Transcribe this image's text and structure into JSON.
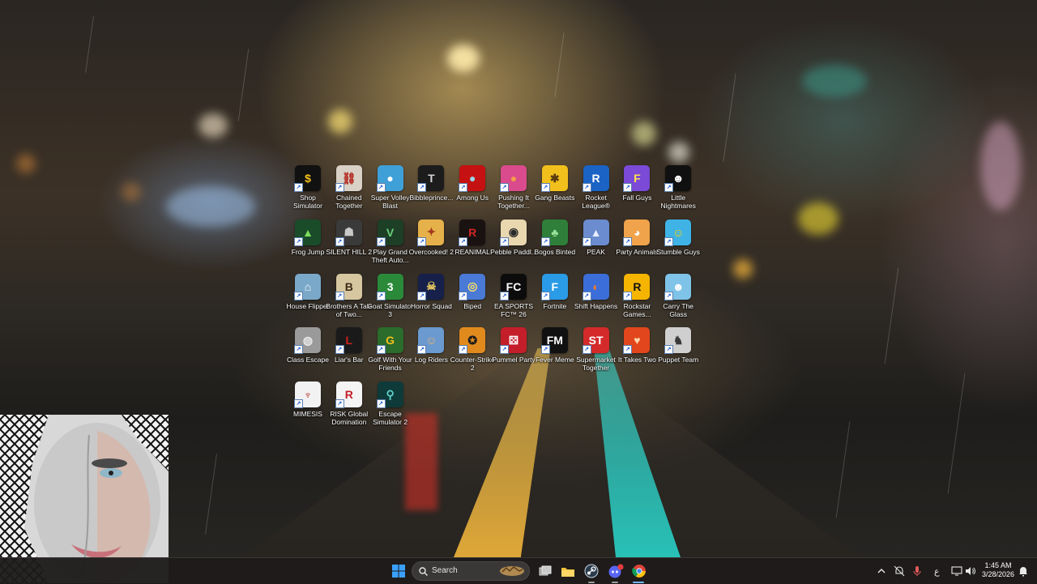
{
  "desktop": {
    "icons": [
      {
        "label": "Shop Simulator",
        "glyph": "$",
        "bg": "#111111",
        "fg": "#f6c21a"
      },
      {
        "label": "Chained Together",
        "glyph": "⛓",
        "bg": "#d9d1c6",
        "fg": "#b3261e"
      },
      {
        "label": "Super Volley Blast",
        "glyph": "●",
        "bg": "#3fa0d8",
        "fg": "#ffffff"
      },
      {
        "label": "Bibbleprince...",
        "glyph": "T",
        "bg": "#1c1c1c",
        "fg": "#d6d6d6"
      },
      {
        "label": "Among Us",
        "glyph": "●",
        "bg": "#c51111",
        "fg": "#9ad4e8"
      },
      {
        "label": "Pushing It Together...",
        "glyph": "●",
        "bg": "#d94b8c",
        "fg": "#f59b4a"
      },
      {
        "label": "Gang Beasts",
        "glyph": "✱",
        "bg": "#f2c01c",
        "fg": "#5a3b10"
      },
      {
        "label": "Rocket League®",
        "glyph": "R",
        "bg": "#1b63c4",
        "fg": "#ffffff"
      },
      {
        "label": "Fall Guys",
        "glyph": "F",
        "bg": "#7b4ad6",
        "fg": "#ffe14d"
      },
      {
        "label": "Little Nightmares",
        "glyph": "☻",
        "bg": "#101010",
        "fg": "#ffffff"
      },
      {
        "label": "Frog Jump",
        "glyph": "▲",
        "bg": "#1a4c2a",
        "fg": "#7ddc5a"
      },
      {
        "label": "SILENT HILL 2",
        "glyph": "☗",
        "bg": "#3a3a3a",
        "fg": "#c8c8c8"
      },
      {
        "label": "Play Grand Theft Auto...",
        "glyph": "V",
        "bg": "#1d3f26",
        "fg": "#6bd07b"
      },
      {
        "label": "Overcooked! 2",
        "glyph": "✦",
        "bg": "#e6b14a",
        "fg": "#a33b1e"
      },
      {
        "label": "REANIMAL",
        "glyph": "R",
        "bg": "#1a1111",
        "fg": "#d02626"
      },
      {
        "label": "Pebble Paddl...",
        "glyph": "◉",
        "bg": "#e9d7b0",
        "fg": "#2a2a2a"
      },
      {
        "label": "Bogos Binted",
        "glyph": "♣",
        "bg": "#2f7f3a",
        "fg": "#9ae39a"
      },
      {
        "label": "PEAK",
        "glyph": "▲",
        "bg": "#6b8ccf",
        "fg": "#e8eefc"
      },
      {
        "label": "Party Animals",
        "glyph": "◕",
        "bg": "#f0a34a",
        "fg": "#ffffff"
      },
      {
        "label": "Stumble Guys",
        "glyph": "☺",
        "bg": "#3fb3e6",
        "fg": "#ffd200"
      },
      {
        "label": "House Flipper",
        "glyph": "⌂",
        "bg": "#7aa8c8",
        "fg": "#ffffff"
      },
      {
        "label": "Brothers A Tale of Two...",
        "glyph": "B",
        "bg": "#d7c7a0",
        "fg": "#3a2a16"
      },
      {
        "label": "Goat Simulator 3",
        "glyph": "3",
        "bg": "#2a8a3a",
        "fg": "#ffffff"
      },
      {
        "label": "Horror Squad",
        "glyph": "☠",
        "bg": "#16204a",
        "fg": "#e8c860"
      },
      {
        "label": "Biped",
        "glyph": "◎",
        "bg": "#4a7ad6",
        "fg": "#ffe066"
      },
      {
        "label": "EA SPORTS FC™ 26",
        "glyph": "FC",
        "bg": "#0c0c0c",
        "fg": "#ffffff"
      },
      {
        "label": "Fortnite",
        "glyph": "F",
        "bg": "#2a9be6",
        "fg": "#ffffff"
      },
      {
        "label": "Shift Happens",
        "glyph": "◐",
        "bg": "#3b6ed8",
        "fg": "#ff7a2a"
      },
      {
        "label": "Rockstar Games...",
        "glyph": "R",
        "bg": "#f4b400",
        "fg": "#111111"
      },
      {
        "label": "Carry The Glass",
        "glyph": "☻",
        "bg": "#7fc3e8",
        "fg": "#ffffff"
      },
      {
        "label": "Class Escape",
        "glyph": "◍",
        "bg": "#9a9a9a",
        "fg": "#e8e8e8"
      },
      {
        "label": "Liar's Bar",
        "glyph": "L",
        "bg": "#1a1a1a",
        "fg": "#d11f1f"
      },
      {
        "label": "Golf With Your Friends",
        "glyph": "G",
        "bg": "#2b6b2b",
        "fg": "#f2c01c"
      },
      {
        "label": "Log Riders",
        "glyph": "☺",
        "bg": "#6a9ad0",
        "fg": "#f0b070"
      },
      {
        "label": "Counter-Strike 2",
        "glyph": "✪",
        "bg": "#e08a1e",
        "fg": "#1a1a1a"
      },
      {
        "label": "Pummel Party",
        "glyph": "⚄",
        "bg": "#c41e2a",
        "fg": "#ffffff"
      },
      {
        "label": "Fever Meme",
        "glyph": "FM",
        "bg": "#111111",
        "fg": "#ffffff"
      },
      {
        "label": "Supermarket Together",
        "glyph": "ST",
        "bg": "#d42a2a",
        "fg": "#ffffff"
      },
      {
        "label": "It Takes Two",
        "glyph": "♥",
        "bg": "#e2461c",
        "fg": "#ffd3a8"
      },
      {
        "label": "Puppet Team",
        "glyph": "♞",
        "bg": "#cfcfcf",
        "fg": "#3a3a3a"
      },
      {
        "label": "MIMESIS",
        "glyph": "♆",
        "bg": "#f2f2f2",
        "fg": "#b3261e"
      },
      {
        "label": "RISK Global Domination",
        "glyph": "R",
        "bg": "#f4f4f4",
        "fg": "#c41e2a"
      },
      {
        "label": "Escape Simulator 2",
        "glyph": "⚲",
        "bg": "#0f3a3a",
        "fg": "#5fd0c8"
      }
    ]
  },
  "taskbar": {
    "search_placeholder": "Search",
    "tray_lang": "ع",
    "clock_time": "1:45 AM",
    "clock_date": "3/28/2026",
    "discord_badge": "1"
  },
  "colors": {
    "taskbar_bg": "#1e1c1b",
    "windows_blue": "#3aa0ff"
  }
}
